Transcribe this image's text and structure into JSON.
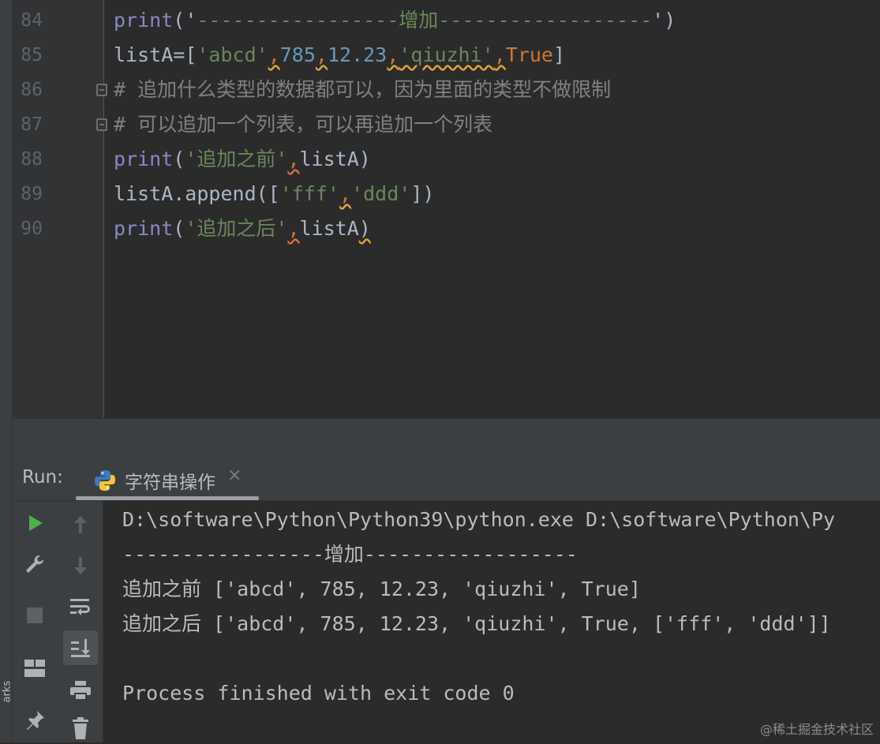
{
  "left_stripe_label": "arks",
  "editor": {
    "lines": [
      {
        "num": "84",
        "t": [
          "print",
          "('",
          "-----------------增加------------------",
          "')"
        ]
      },
      {
        "num": "85",
        "t": [
          "listA",
          "=[",
          "'abcd'",
          ",",
          "785",
          ",",
          "12.23",
          ",",
          "'qiuzhi'",
          ",",
          "True",
          "]"
        ]
      },
      {
        "num": "86",
        "t": [
          "# 追加什么类型的数据都可以，因为里面的类型不做限制"
        ]
      },
      {
        "num": "87",
        "t": [
          "# 可以追加一个列表，可以再追加一个列表"
        ]
      },
      {
        "num": "88",
        "t": [
          "print",
          "(",
          "'追加之前'",
          ",",
          "listA",
          ")"
        ]
      },
      {
        "num": "89",
        "t": [
          "listA.append([",
          "'fff'",
          ",",
          "'ddd'",
          "])"
        ]
      },
      {
        "num": "90",
        "t": [
          "print",
          "(",
          "'追加之后'",
          ",",
          "listA",
          ")"
        ]
      }
    ]
  },
  "run": {
    "label": "Run:",
    "tab_title": "字符串操作",
    "tab_close": "×",
    "icons": [
      "run-icon",
      "wrench-icon",
      "stop-icon",
      "layout-icon",
      "pin-icon",
      "up-arrow-icon",
      "down-arrow-icon",
      "soft-wrap-icon",
      "scroll-to-end-icon",
      "print-icon",
      "trash-icon"
    ],
    "output": [
      "D:\\software\\Python\\Python39\\python.exe D:\\software\\Python\\Py",
      "-----------------增加------------------",
      "追加之前 ['abcd', 785, 12.23, 'qiuzhi', True]",
      "追加之后 ['abcd', 785, 12.23, 'qiuzhi', True, ['fff', 'ddd']]",
      "",
      "Process finished with exit code 0"
    ]
  },
  "watermark": "@稀土掘金技术社区",
  "colors": {
    "accent_run": "#4caf50",
    "string": "#6a8759",
    "number": "#6897bb",
    "keyword": "#cc7832",
    "builtin": "#8888c6",
    "comment": "#808080"
  }
}
